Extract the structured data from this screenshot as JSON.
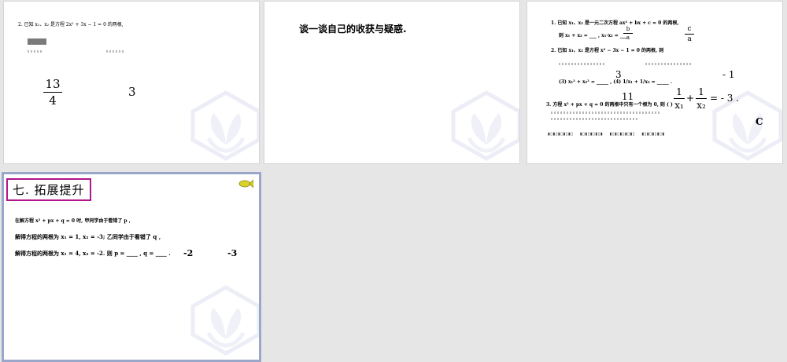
{
  "slides": [
    {
      "id": "slide-1",
      "problem": "2. 已知 x₁、x₂ 是方程 2x² + 3x − 1 = 0 的两根,",
      "answer_fraction": {
        "num": "13",
        "den": "4"
      },
      "answer_value": "3"
    },
    {
      "id": "slide-2",
      "text": "谈一谈自己的收获与疑惑."
    },
    {
      "id": "slide-3",
      "line1": "1. 已知 x₁、x₂ 是一元二次方程 ax² + bx + c = 0 的两根,",
      "line2": "则 x₁ + x₂ = ___ , x₁·x₂ = ___",
      "frac_b": {
        "num": "b",
        "den": "a"
      },
      "frac_c": {
        "num": "c",
        "den": "a"
      },
      "line3": "2. 已知 x₁、x₂ 是方程 x² − 3x − 1 = 0 的两根, 则",
      "line4": "(3) x₁² + x₂² = _____ , (4) 1/x₁ + 1/x₂ = _____ .",
      "val_neg1": "- 1",
      "val_3": "3",
      "val_11": "11",
      "frac_x1": {
        "num": "1",
        "den": "x₁"
      },
      "frac_x2": {
        "num": "1",
        "den": "x₂"
      },
      "result": "= - 3 .",
      "line5": "3. 方程 x² + px + q = 0 的两根中只有一个根为 0, 则 (     )",
      "choice": "C"
    },
    {
      "id": "slide-4",
      "title": "七. 拓展提升",
      "line1": "在解方程 x² + px + q = 0 时, 甲同学由于看错了 p ,",
      "line2": "解得方程的两根为 x₁ = 1, x₂ = -3; 乙同学由于看错了 q ,",
      "line3": "解得方程的两根为 x₁ = 4, x₂ = -2. 则 p = ____ , q = ____ .",
      "ans_p": "-2",
      "ans_q": "-3"
    }
  ]
}
